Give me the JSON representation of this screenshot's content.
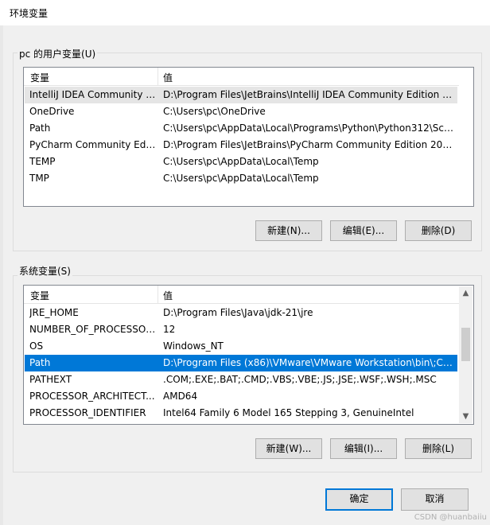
{
  "window": {
    "title": "环境变量"
  },
  "user_vars": {
    "group_label": "pc 的用户变量(U)",
    "col_name": "变量",
    "col_value": "值",
    "rows": [
      {
        "name": "IntelliJ IDEA Community E...",
        "value": "D:\\Program Files\\JetBrains\\IntelliJ IDEA Community Edition 2..."
      },
      {
        "name": "OneDrive",
        "value": "C:\\Users\\pc\\OneDrive"
      },
      {
        "name": "Path",
        "value": "C:\\Users\\pc\\AppData\\Local\\Programs\\Python\\Python312\\Scri..."
      },
      {
        "name": "PyCharm Community Editi...",
        "value": "D:\\Program Files\\JetBrains\\PyCharm Community Edition 2023..."
      },
      {
        "name": "TEMP",
        "value": "C:\\Users\\pc\\AppData\\Local\\Temp"
      },
      {
        "name": "TMP",
        "value": "C:\\Users\\pc\\AppData\\Local\\Temp"
      }
    ],
    "buttons": {
      "new": "新建(N)...",
      "edit": "编辑(E)...",
      "delete": "删除(D)"
    }
  },
  "system_vars": {
    "group_label": "系统变量(S)",
    "col_name": "变量",
    "col_value": "值",
    "rows": [
      {
        "name": "JRE_HOME",
        "value": "D:\\Program Files\\Java\\jdk-21\\jre"
      },
      {
        "name": "NUMBER_OF_PROCESSORS",
        "value": "12"
      },
      {
        "name": "OS",
        "value": "Windows_NT"
      },
      {
        "name": "Path",
        "value": "D:\\Program Files (x86)\\VMware\\VMware Workstation\\bin\\;C:\\..."
      },
      {
        "name": "PATHEXT",
        "value": ".COM;.EXE;.BAT;.CMD;.VBS;.VBE;.JS;.JSE;.WSF;.WSH;.MSC"
      },
      {
        "name": "PROCESSOR_ARCHITECT...",
        "value": "AMD64"
      },
      {
        "name": "PROCESSOR_IDENTIFIER",
        "value": "Intel64 Family 6 Model 165 Stepping 3, GenuineIntel"
      }
    ],
    "selected_row": "Path",
    "buttons": {
      "new": "新建(W)...",
      "edit": "编辑(I)...",
      "delete": "删除(L)"
    }
  },
  "footer": {
    "ok": "确定",
    "cancel": "取消"
  },
  "watermark": "CSDN @huanbaiiu",
  "colors": {
    "accent": "#0078d7",
    "button_bg": "#e1e1e1",
    "dialog_bg": "#f0f0f0"
  }
}
